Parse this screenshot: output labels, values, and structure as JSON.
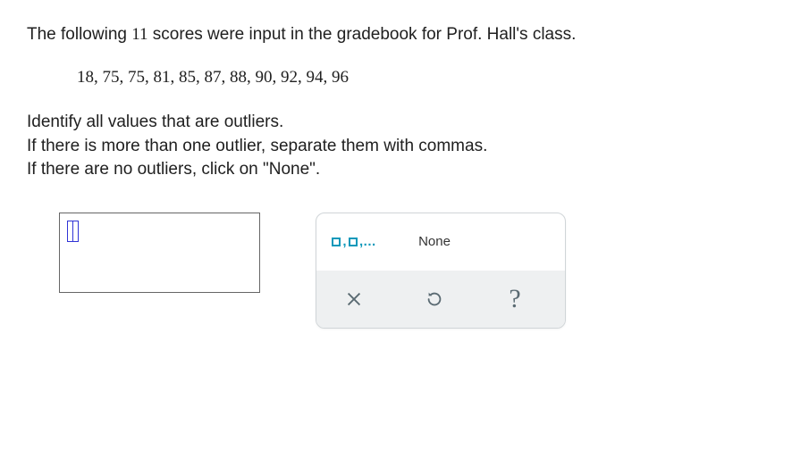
{
  "question": {
    "line1_pre": "The following ",
    "count": "11",
    "line1_post": " scores were input in the gradebook for Prof. Hall's class.",
    "data_values": "18, 75, 75, 81, 85, 87, 88, 90, 92, 94, 96",
    "line2": "Identify all values that are outliers.",
    "line3": "If there is more than one outlier, separate them with commas.",
    "line4": "If there are no outliers, click on \"None\"."
  },
  "answer": {
    "value": ""
  },
  "tools": {
    "comma_template_label": ",",
    "comma_template_trailing": ",...",
    "none_label": "None",
    "help_label": "?"
  }
}
